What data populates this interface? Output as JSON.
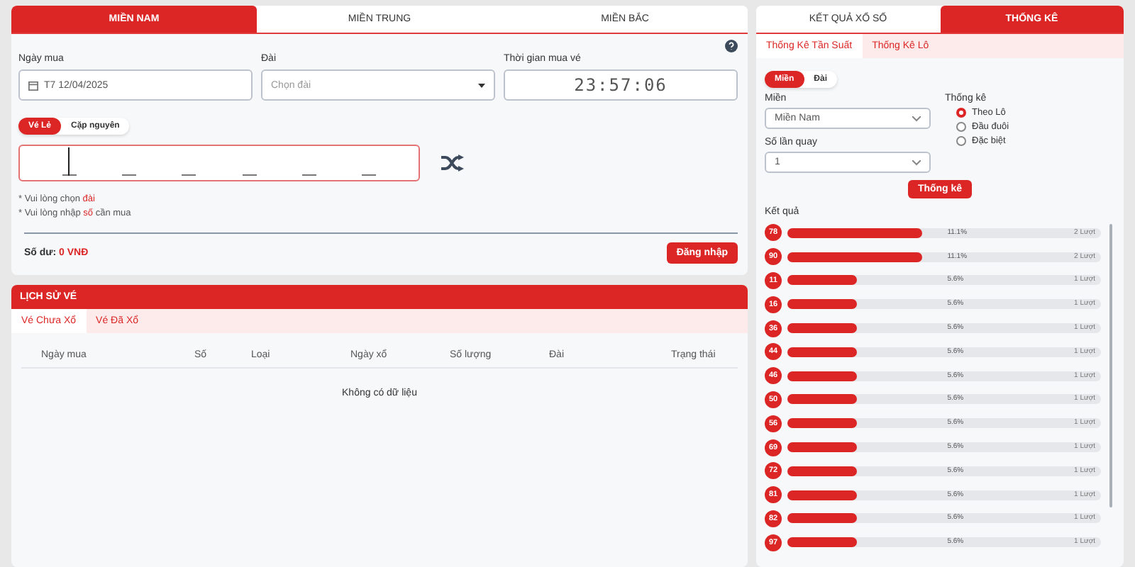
{
  "region_tabs": [
    {
      "label": "MIỀN NAM",
      "selected": true
    },
    {
      "label": "MIỀN TRUNG",
      "selected": false
    },
    {
      "label": "MIỀN BẮC",
      "selected": false
    }
  ],
  "purchase_form": {
    "fields": [
      {
        "kind": "date",
        "label": "Ngày mua",
        "value": "T7 12/04/2025"
      },
      {
        "kind": "select",
        "label": "Đài",
        "placeholder": "Chọn đài"
      },
      {
        "kind": "clock",
        "label": "Thời gian mua vé",
        "value": "23:57:06"
      }
    ],
    "ticket_types": [
      {
        "label": "Vé Lẻ",
        "selected": true
      },
      {
        "label": "Cặp nguyên",
        "selected": false
      }
    ],
    "digit_slots": [
      {
        "focused": true
      },
      {
        "focused": false
      },
      {
        "focused": false
      },
      {
        "focused": false
      },
      {
        "focused": false
      },
      {
        "focused": false
      }
    ],
    "hints": [
      {
        "before": "* Vui lòng chọn ",
        "highlight": "đài"
      },
      {
        "before": "* Vui lòng nhập ",
        "highlight": "số",
        "after": " cần mua"
      }
    ],
    "balance": {
      "label": "Số dư:",
      "value": "0 VNĐ"
    },
    "login_button": "Đăng nhập"
  },
  "history": {
    "title": "LỊCH SỬ VÉ",
    "tabs": [
      {
        "label": "Vé Chưa Xổ",
        "selected": true
      },
      {
        "label": "Vé Đã Xổ",
        "selected": false
      }
    ],
    "columns": [
      "Ngày mua",
      "Số",
      "Loại",
      "Ngày xổ",
      "Số lượng",
      "Đài",
      "Trạng thái"
    ],
    "empty_text": "Không có dữ liệu"
  },
  "stats": {
    "tabs": [
      {
        "label": "KẾT QUẢ XỔ SỐ",
        "selected": false
      },
      {
        "label": "THỐNG KÊ",
        "selected": true
      }
    ],
    "subtabs": [
      {
        "label": "Thống Kê Tần Suất",
        "selected": true
      },
      {
        "label": "Thống Kê Lô",
        "selected": false
      }
    ],
    "mode_toggle": [
      {
        "label": "Miền",
        "selected": true
      },
      {
        "label": "Đài",
        "selected": false
      }
    ],
    "region": {
      "label": "Miền",
      "value": "Miền Nam"
    },
    "spins": {
      "label": "Số lần quay",
      "value": "1"
    },
    "stat_type": {
      "label": "Thống kê",
      "options": [
        {
          "label": "Theo Lô",
          "selected": true
        },
        {
          "label": "Đầu đuôi",
          "selected": false
        },
        {
          "label": "Đặc biệt",
          "selected": false
        }
      ]
    },
    "submit_button": "Thống kê",
    "results_title": "Kết quả",
    "results": [
      {
        "number": "78",
        "level": 0.43,
        "percent": "11.1%",
        "count": "2 Lượt"
      },
      {
        "number": "90",
        "level": 0.43,
        "percent": "11.1%",
        "count": "2 Lượt"
      },
      {
        "number": "11",
        "level": 0.22,
        "percent": "5.6%",
        "count": "1 Lượt"
      },
      {
        "number": "16",
        "level": 0.22,
        "percent": "5.6%",
        "count": "1 Lượt"
      },
      {
        "number": "36",
        "level": 0.22,
        "percent": "5.6%",
        "count": "1 Lượt"
      },
      {
        "number": "44",
        "level": 0.22,
        "percent": "5.6%",
        "count": "1 Lượt"
      },
      {
        "number": "46",
        "level": 0.22,
        "percent": "5.6%",
        "count": "1 Lượt"
      },
      {
        "number": "50",
        "level": 0.22,
        "percent": "5.6%",
        "count": "1 Lượt"
      },
      {
        "number": "56",
        "level": 0.22,
        "percent": "5.6%",
        "count": "1 Lượt"
      },
      {
        "number": "69",
        "level": 0.22,
        "percent": "5.6%",
        "count": "1 Lượt"
      },
      {
        "number": "72",
        "level": 0.22,
        "percent": "5.6%",
        "count": "1 Lượt"
      },
      {
        "number": "81",
        "level": 0.22,
        "percent": "5.6%",
        "count": "1 Lượt"
      },
      {
        "number": "82",
        "level": 0.22,
        "percent": "5.6%",
        "count": "1 Lượt"
      },
      {
        "number": "97",
        "level": 0.22,
        "percent": "5.6%",
        "count": "1 Lượt"
      }
    ]
  }
}
